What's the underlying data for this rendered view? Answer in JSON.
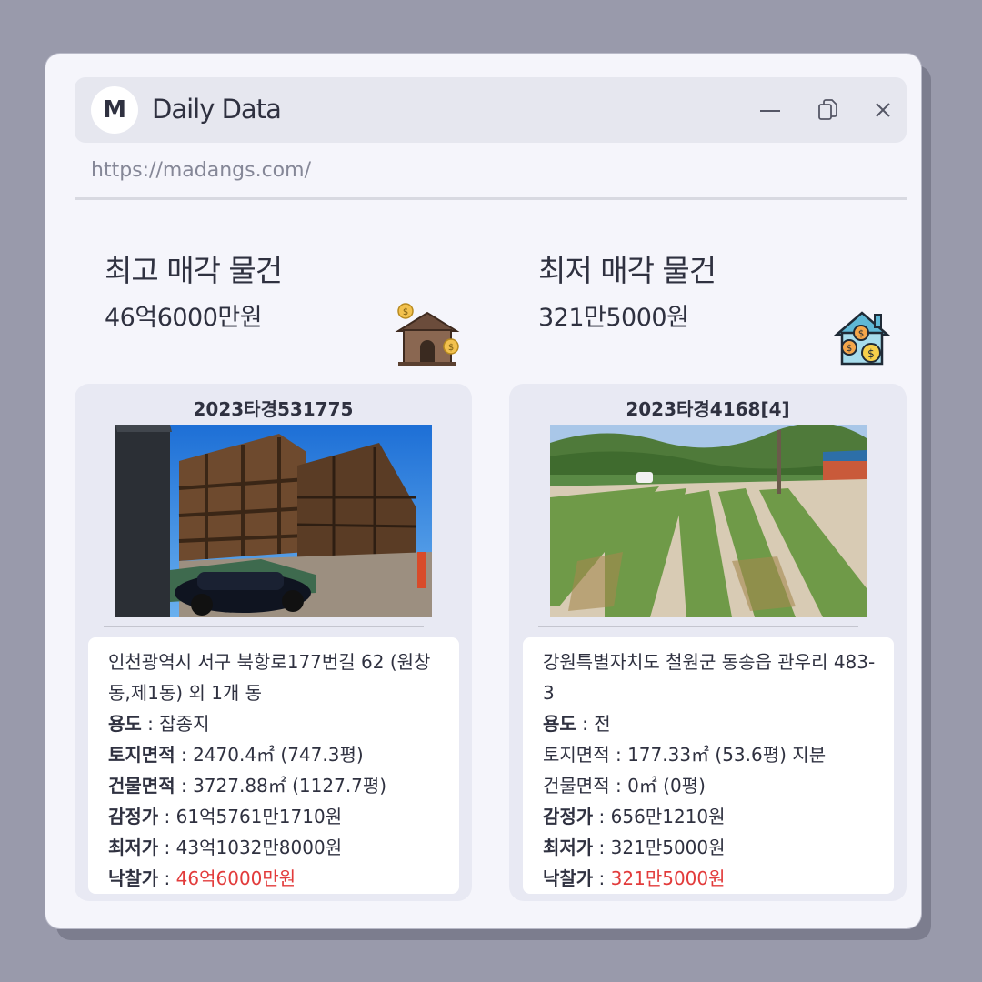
{
  "window": {
    "logo_letter": "M",
    "title": "Daily Data",
    "url": "https://madangs.com/",
    "controls": [
      "minimize",
      "copy",
      "close"
    ]
  },
  "left": {
    "heading": "최고 매각 물건",
    "price": "46억6000만원",
    "icon": "house-with-coins-icon",
    "card": {
      "case_no": "2023타경531775",
      "photo": "multi-storey-building-under-demolition-photo",
      "address": "인천광역시 서구 북항로177번길 62 (원창동,제1동) 외 1개 동",
      "use_label": "용도",
      "use_value": " : 잡종지",
      "land_label": "토지면적",
      "land_value": " : 2470.4㎡ (747.3평)",
      "bldg_label": "건물면적",
      "bldg_value": " : 3727.88㎡ (1127.7평)",
      "appraisal_label": "감정가",
      "appraisal_value": " : 61억5761만1710원",
      "min_label": "최저가",
      "min_value": " : 43억1032만8000원",
      "sold_label": "낙찰가",
      "sold_sep": " : ",
      "sold_value": "46억6000만원"
    }
  },
  "right": {
    "heading": "최저 매각 물건",
    "price": "321만5000원",
    "icon": "house-with-dollar-coins-icon",
    "card": {
      "case_no": "2023타경4168[4]",
      "photo": "farm-field-with-mountains-photo",
      "address": "강원특별자치도 철원군 동송읍 관우리 483-3",
      "use_label": "용도",
      "use_value": " : 전",
      "land_label": "토지면적",
      "land_value": " : 177.33㎡ (53.6평) 지분",
      "bldg_label": "건물면적",
      "bldg_value": " : 0㎡ (0평)",
      "appraisal_label": "감정가",
      "appraisal_value": " : 656만1210원",
      "min_label": "최저가",
      "min_value": " : 321만5000원",
      "sold_label": "낙찰가",
      "sold_sep": " : ",
      "sold_value": "321만5000원"
    }
  },
  "colors": {
    "background": "#999aab",
    "window": "#f5f5fb",
    "titlebar": "#e6e7ef",
    "card": "#e8e9f3",
    "accent_red": "#e23b3b",
    "text": "#2f3140"
  }
}
